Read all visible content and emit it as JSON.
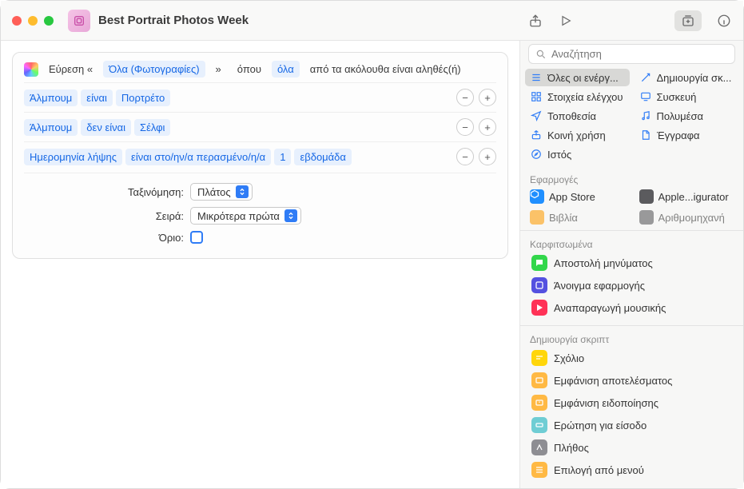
{
  "window": {
    "title": "Best Portrait Photos Week"
  },
  "toolbar": {
    "share": "share-icon",
    "run": "play-icon",
    "library": "library-icon",
    "info": "info-icon"
  },
  "action": {
    "find_prefix": "Εύρεση «",
    "scope": "Όλα (Φωτογραφίες)",
    "arrow": "»",
    "where": "όπου",
    "quant": "όλα",
    "suffix": "από τα ακόλουθα είναι αληθές(ή)",
    "rules": [
      {
        "a": "Άλμπουμ",
        "op": "είναι",
        "b": "Πορτρέτο"
      },
      {
        "a": "Άλμπουμ",
        "op": "δεν είναι",
        "b": "Σέλφι"
      },
      {
        "a": "Ημερομηνία λήψης",
        "op": "είναι στο/ην/α περασμένο/η/α",
        "n": "1",
        "unit": "εβδομάδα"
      }
    ],
    "sort_label": "Ταξινόμηση:",
    "sort_value": "Πλάτος",
    "order_label": "Σειρά:",
    "order_value": "Μικρότερα πρώτα",
    "limit_label": "Όριο:"
  },
  "sidebar": {
    "search_placeholder": "Αναζήτηση",
    "categories": [
      {
        "label": "Όλες οι ενέργ...",
        "color": "#2f7cf6",
        "selected": true
      },
      {
        "label": "Δημιουργία σκ...",
        "color": "#2f7cf6"
      },
      {
        "label": "Στοιχεία ελέγχου",
        "color": "#2f7cf6"
      },
      {
        "label": "Συσκευή",
        "color": "#2f7cf6"
      },
      {
        "label": "Τοποθεσία",
        "color": "#2f7cf6"
      },
      {
        "label": "Πολυμέσα",
        "color": "#2f7cf6"
      },
      {
        "label": "Κοινή χρήση",
        "color": "#2f7cf6"
      },
      {
        "label": "Έγγραφα",
        "color": "#2f7cf6"
      },
      {
        "label": "Ιστός",
        "color": "#2f7cf6"
      }
    ],
    "apps_header": "Εφαρμογές",
    "apps": [
      {
        "label": "App Store",
        "bg": "#1f8fff"
      },
      {
        "label": "Apple...igurator",
        "bg": "#5b5b5e"
      },
      {
        "label": "Βιβλία",
        "bg": "#ff9f0a"
      },
      {
        "label": "Αριθμομηχανή",
        "bg": "#5b5b5e"
      }
    ],
    "pinned_header": "Καρφιτσωμένα",
    "pinned": [
      {
        "label": "Αποστολή μηνύματος",
        "bg": "#32d74b"
      },
      {
        "label": "Άνοιγμα εφαρμογής",
        "bg": "#5451e0"
      },
      {
        "label": "Αναπαραγωγή μουσικής",
        "bg": "#ff3257"
      }
    ],
    "script_header": "Δημιουργία σκριπτ",
    "script": [
      {
        "label": "Σχόλιο",
        "bg": "#ffd60a"
      },
      {
        "label": "Εμφάνιση αποτελέσματος",
        "bg": "#ffb944"
      },
      {
        "label": "Εμφάνιση ειδοποίησης",
        "bg": "#ffb944"
      },
      {
        "label": "Ερώτηση για είσοδο",
        "bg": "#6fcdd4"
      },
      {
        "label": "Πλήθος",
        "bg": "#8e8e93"
      },
      {
        "label": "Επιλογή από μενού",
        "bg": "#ffb944"
      }
    ]
  }
}
